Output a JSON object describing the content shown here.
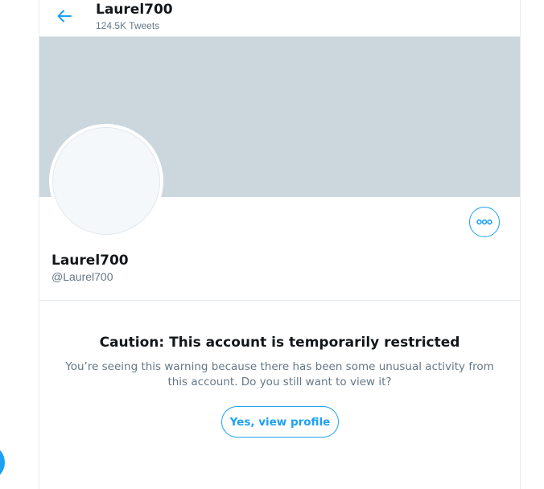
{
  "header": {
    "title": "Laurel700",
    "tweet_count": "124.5K Tweets"
  },
  "profile": {
    "name": "Laurel700",
    "handle": "@Laurel700"
  },
  "warning": {
    "title": "Caution: This account is temporarily restricted",
    "message": "You’re seeing this warning because there has been some unusual activity from this account. Do you still want to view it?",
    "button_label": "Yes, view profile"
  },
  "icons": {
    "back": "arrow-left-icon",
    "more": "more-options-icon"
  },
  "colors": {
    "accent": "#1da1f2",
    "banner": "#ccd6dd",
    "secondary_text": "#657786",
    "primary_text": "#14171a"
  }
}
